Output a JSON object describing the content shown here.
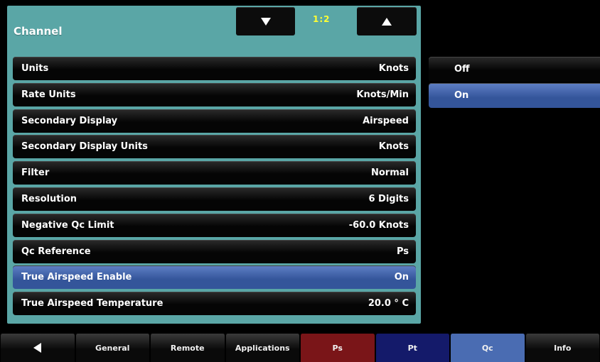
{
  "colors": {
    "panel_bg": "#5aa6a6",
    "page_indicator": "#ffff33",
    "selected_row": "#4a6cb2",
    "tab_ps": "#7a1518",
    "tab_pt": "#141a6a",
    "tab_qc": "#4a6cb2"
  },
  "header": {
    "title": "Channel",
    "page_indicator": "1:2",
    "page_down_icon": "triangle-down-icon",
    "page_up_icon": "triangle-up-icon"
  },
  "settings": [
    {
      "label": "Units",
      "value": "Knots",
      "selected": false
    },
    {
      "label": "Rate Units",
      "value": "Knots/Min",
      "selected": false
    },
    {
      "label": "Secondary Display",
      "value": "Airspeed",
      "selected": false
    },
    {
      "label": "Secondary Display Units",
      "value": "Knots",
      "selected": false
    },
    {
      "label": "Filter",
      "value": "Normal",
      "selected": false
    },
    {
      "label": "Resolution",
      "value": "6 Digits",
      "selected": false
    },
    {
      "label": "Negative Qc Limit",
      "value": "-60.0 Knots",
      "selected": false
    },
    {
      "label": "Qc Reference",
      "value": "Ps",
      "selected": false
    },
    {
      "label": "True Airspeed Enable",
      "value": "On",
      "selected": true
    },
    {
      "label": "True Airspeed Temperature",
      "value": "20.0 ° C",
      "selected": false
    }
  ],
  "options": [
    {
      "label": "Off",
      "selected": false
    },
    {
      "label": "On",
      "selected": true
    }
  ],
  "tabs": [
    {
      "label": "",
      "icon": "triangle-left-icon",
      "color": ""
    },
    {
      "label": "General",
      "color": ""
    },
    {
      "label": "Remote",
      "color": ""
    },
    {
      "label": "Applications",
      "color": ""
    },
    {
      "label": "Ps",
      "color": "#7a1518"
    },
    {
      "label": "Pt",
      "color": "#141a6a"
    },
    {
      "label": "Qc",
      "color": "#4a6cb2"
    },
    {
      "label": "Info",
      "color": ""
    }
  ]
}
